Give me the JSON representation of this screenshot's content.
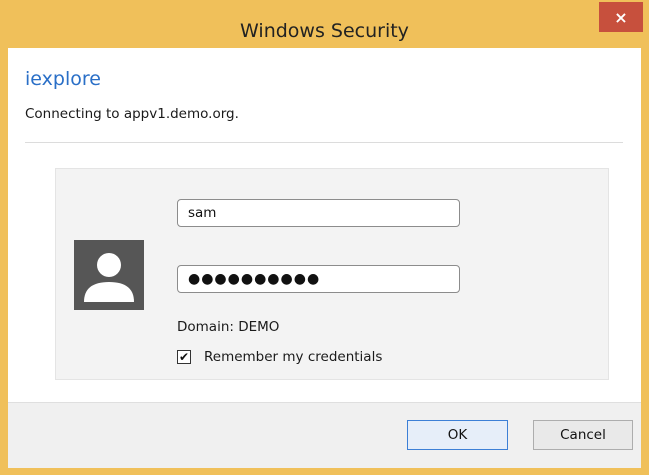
{
  "window": {
    "title": "Windows Security",
    "close_label": "×",
    "accent": "#f0c05a",
    "close_bg": "#c7503d"
  },
  "header": {
    "app_name": "iexplore",
    "subtitle": "Connecting to appv1.demo.org."
  },
  "credentials": {
    "username_value": "sam",
    "password_value": "●●●●●●●●●●",
    "domain_text": "Domain: DEMO",
    "remember_label": "Remember my credentials",
    "remember_checked": true,
    "checkmark": "✔",
    "avatar_icon": "user-avatar-icon"
  },
  "buttons": {
    "ok_label": "OK",
    "cancel_label": "Cancel"
  }
}
